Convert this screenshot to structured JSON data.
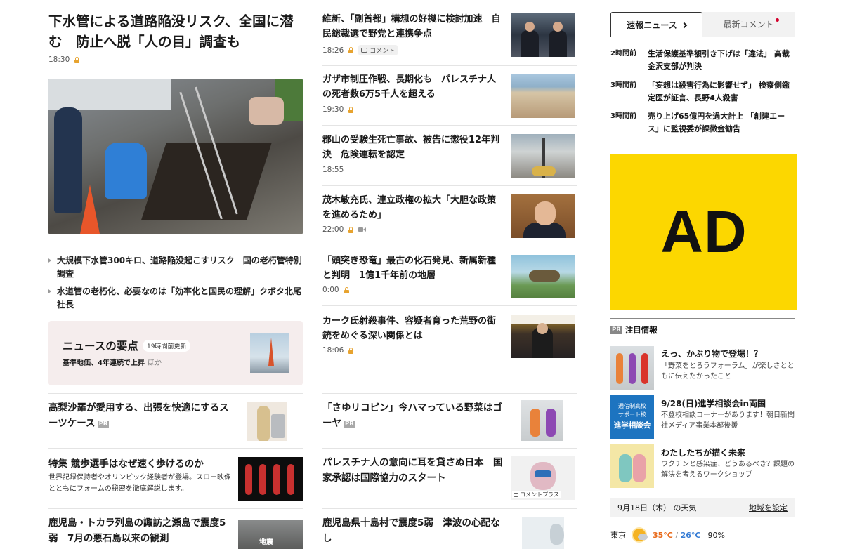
{
  "left": {
    "top_story": {
      "title": "下水管による道路陥没リスク、全国に潜む　防止へ脱「人の目」調査も",
      "time": "18:30"
    },
    "related": [
      "大規模下水管300キロ、道路陥没起こすリスク　国の老朽管特別調査",
      "水道管の老朽化、必要なのは「効率化と国民の理解」クボタ北尾社長"
    ],
    "summary": {
      "title": "ニュースの要点",
      "badge": "19時間前更新",
      "sub": "基準地価、4年連続で上昇",
      "more": "ほか"
    },
    "stories": [
      {
        "title": "高梨沙羅が愛用する、出張を快適にするスーツケース",
        "pr": "PR"
      },
      {
        "title": "特集 競歩選手はなぜ速く歩けるのか",
        "desc": "世界記録保持者やオリンピック経験者が登場。スロー映像とともにフォームの秘密を徹底解説します。"
      },
      {
        "title": "鹿児島・トカラ列島の諏訪之瀬島で震度5弱　7月の悪石島以来の観測",
        "thumb_label": "地震"
      }
    ]
  },
  "mid": {
    "items": [
      {
        "title": "維新、「副首都」構想の好機に検討加速　自民総裁選で野党と連携争点",
        "time": "18:26",
        "comment": "コメント"
      },
      {
        "title": "ガザ市制圧作戦、長期化も　パレスチナ人の死者数6万5千人を超える",
        "time": "19:30"
      },
      {
        "title": "郡山の受験生死亡事故、被告に懲役12年判決　危険運転を認定",
        "time": "18:55"
      },
      {
        "title": "茂木敏充氏、連立政権の拡大「大胆な政策を進めるため」",
        "time": "22:00"
      },
      {
        "title": "「頭突き恐竜」最古の化石発見、新属新種と判明　1億1千年前の地層",
        "time": "0:00"
      },
      {
        "title": "カーク氏射殺事件、容疑者育った荒野の街　銃をめぐる深い関係とは",
        "time": "18:06"
      }
    ],
    "lower": [
      {
        "title": "「さゆリコピン」今ハマっている野菜はゴーヤ",
        "pr": "PR"
      },
      {
        "title": "パレスチナ人の意向に耳を貸さぬ日本　国家承認は国際協力のスタート",
        "badge": "コメントプラス"
      },
      {
        "title": "鹿児島県十島村で震度5弱　津波の心配なし"
      }
    ]
  },
  "right": {
    "tabs": [
      "速報ニュース",
      "最新コメント"
    ],
    "breaking": [
      {
        "time": "2時間前",
        "text": "生活保護基準額引き下げは「違法」 高裁金沢支部が判決"
      },
      {
        "time": "3時間前",
        "text": "「妄想は殺害行為に影響せず」 検察側鑑定医が証言、長野4人殺害"
      },
      {
        "time": "3時間前",
        "text": "売り上げ65億円を過大計上 「創建エース」に監視委が課徴金勧告"
      }
    ],
    "ad_label": "AD",
    "pr_section": {
      "badge": "PR",
      "title": "注目情報",
      "items": [
        {
          "title": "えっ、かぶり物で登場！？",
          "desc": "「野菜をとろうフォーラム」が楽しさとともに伝えたかったこと"
        },
        {
          "title": "9/28(日)進学相談会in両国",
          "desc": "不登校相談コーナーがあります！朝日新聞社メディア事業本部後援",
          "thumb_top": "通信制高校",
          "thumb_mid": "サポート校",
          "thumb_big": "進学相談会"
        },
        {
          "title": "わたしたちが描く未来",
          "desc": "ワクチンと感染症、どうあるべき？課題の解決を考えるワークショップ"
        }
      ]
    },
    "weather": {
      "date": "9月18日（木） の天気",
      "set_link": "地域を設定",
      "city": "東京",
      "high": "35°C",
      "low": "26°C",
      "rain": "90%"
    }
  }
}
